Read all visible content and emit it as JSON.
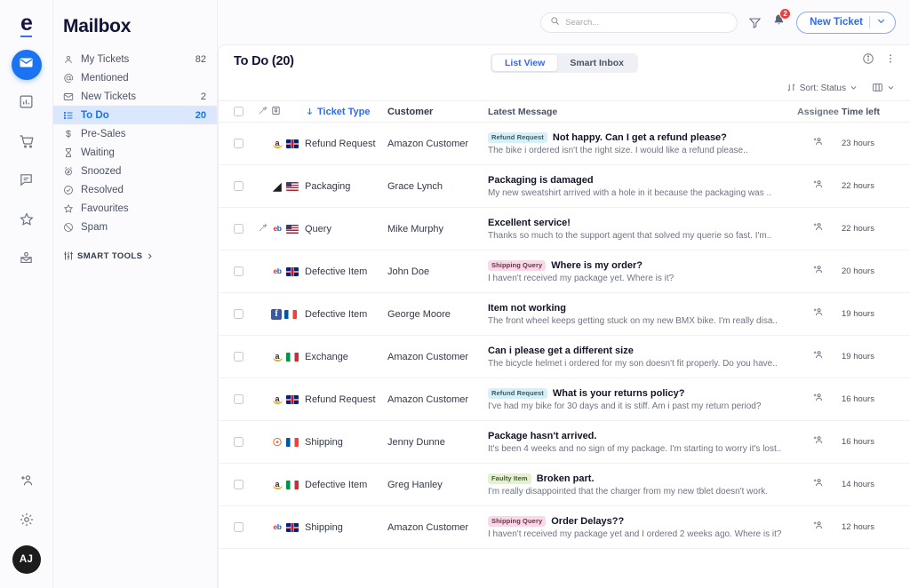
{
  "rail": {
    "logo": "e",
    "items": [
      {
        "name": "mail-icon",
        "active": true
      },
      {
        "name": "chart-icon",
        "active": false
      },
      {
        "name": "cart-icon",
        "active": false
      },
      {
        "name": "chat-icon",
        "active": false
      },
      {
        "name": "star-icon",
        "active": false
      },
      {
        "name": "inbox-person-icon",
        "active": false
      }
    ],
    "bottom": [
      {
        "name": "add-user-icon"
      },
      {
        "name": "gear-icon"
      }
    ],
    "avatar": "AJ"
  },
  "sidebar": {
    "title": "Mailbox",
    "items": [
      {
        "label": "My Tickets",
        "count": "82",
        "icon": "person-icon",
        "active": false
      },
      {
        "label": "Mentioned",
        "count": "",
        "icon": "at-icon",
        "active": false
      },
      {
        "label": "New Tickets",
        "count": "2",
        "icon": "envelope-icon",
        "active": false
      },
      {
        "label": "To Do",
        "count": "20",
        "icon": "list-icon",
        "active": true
      },
      {
        "label": "Pre-Sales",
        "count": "",
        "icon": "dollar-icon",
        "active": false
      },
      {
        "label": "Waiting",
        "count": "",
        "icon": "hourglass-icon",
        "active": false
      },
      {
        "label": "Snoozed",
        "count": "",
        "icon": "alarm-icon",
        "active": false
      },
      {
        "label": "Resolved",
        "count": "",
        "icon": "check-circle-icon",
        "active": false
      },
      {
        "label": "Favourites",
        "count": "",
        "icon": "star-icon",
        "active": false
      },
      {
        "label": "Spam",
        "count": "",
        "icon": "ban-icon",
        "active": false
      }
    ],
    "smart_tools": "SMART TOOLS"
  },
  "topbar": {
    "search_placeholder": "Search...",
    "filter_icon": "filter-icon",
    "bell_icon": "bell-icon",
    "notification_count": "2",
    "new_ticket_label": "New Ticket"
  },
  "panel": {
    "title": "To Do (20)",
    "tabs": [
      {
        "label": "List View",
        "active": true
      },
      {
        "label": "Smart Inbox",
        "active": false
      }
    ],
    "info_icon": "info-icon",
    "more_icon": "more-vertical-icon",
    "sort_label": "Sort: Status",
    "columns_icon": "columns-icon"
  },
  "table": {
    "headers": {
      "checkbox": "",
      "wand": "",
      "channel": "",
      "ticket_type": "Ticket Type",
      "customer": "Customer",
      "latest_message": "Latest Message",
      "assignee": "Assignee",
      "time_left": "Time left"
    },
    "rows": [
      {
        "wand": false,
        "channel": "amazon",
        "flag": "uk",
        "ticket_type": "Refund Request",
        "customer": "Amazon Customer",
        "tag": "Refund Request",
        "tag_style": "tag-refund",
        "subject": "Not happy. Can I get a refund please?",
        "preview": "The bike i ordered isn't the right size. I would like a refund please..",
        "time": "23 hours",
        "bar_pct": 92,
        "bar_color": "#22b24c"
      },
      {
        "wand": false,
        "channel": "dark",
        "flag": "us",
        "ticket_type": "Packaging",
        "customer": "Grace Lynch",
        "tag": "",
        "tag_style": "",
        "subject": "Packaging is damaged",
        "preview": "My new sweatshirt arrived with a hole in it because the packaging was ..",
        "time": "22 hours",
        "bar_pct": 80,
        "bar_color": "#22b24c"
      },
      {
        "wand": true,
        "channel": "ebay",
        "flag": "us",
        "ticket_type": "Query",
        "customer": "Mike Murphy",
        "tag": "",
        "tag_style": "",
        "subject": "Excellent service!",
        "preview": "Thanks so much to the support agent that solved my querie so fast. I'm..",
        "time": "22 hours",
        "bar_pct": 80,
        "bar_color": "#22b24c"
      },
      {
        "wand": false,
        "channel": "ebay",
        "flag": "uk",
        "ticket_type": "Defective Item",
        "customer": "John Doe",
        "tag": "Shipping Query",
        "tag_style": "tag-shipping",
        "subject": "Where is my order?",
        "preview": "I haven't received my package yet. Where is it?",
        "time": "20 hours",
        "bar_pct": 76,
        "bar_color": "#22b24c"
      },
      {
        "wand": false,
        "channel": "facebook",
        "flag": "fr",
        "ticket_type": "Defective Item",
        "customer": "George Moore",
        "tag": "",
        "tag_style": "",
        "subject": "Item not working",
        "preview": "The front wheel keeps getting stuck on my new BMX bike. I'm really disa..",
        "time": "19 hours",
        "bar_pct": 62,
        "bar_color": "#22b24c"
      },
      {
        "wand": false,
        "channel": "amazon",
        "flag": "it",
        "ticket_type": "Exchange",
        "customer": "Amazon Customer",
        "tag": "",
        "tag_style": "",
        "subject": "Can i please get a different size",
        "preview": "The bicycle helmet i ordered for my son doesn't fit properly. Do you have..",
        "time": "19 hours",
        "bar_pct": 62,
        "bar_color": "#22b24c"
      },
      {
        "wand": false,
        "channel": "amazon",
        "flag": "uk",
        "ticket_type": "Refund Request",
        "customer": "Amazon Customer",
        "tag": "Refund Request",
        "tag_style": "tag-refund",
        "subject": "What is your returns policy?",
        "preview": "I've had my bike for 30 days and it is stiff. Am i past my return period?",
        "time": "16 hours",
        "bar_pct": 52,
        "bar_color": "#fbce57"
      },
      {
        "wand": false,
        "channel": "magento",
        "flag": "fr",
        "ticket_type": "Shipping",
        "customer": "Jenny Dunne",
        "tag": "",
        "tag_style": "",
        "subject": "Package hasn't arrived.",
        "preview": "It's been 4 weeks and no sign of my package. I'm starting to worry it's lost..",
        "time": "16 hours",
        "bar_pct": 56,
        "bar_color": "#fbdd8a"
      },
      {
        "wand": false,
        "channel": "amazon",
        "flag": "it",
        "ticket_type": "Defective Item",
        "customer": "Greg Hanley",
        "tag": "Faulty Item",
        "tag_style": "tag-faulty",
        "subject": "Broken part.",
        "preview": "I'm really disappointed that the charger from my new tblet doesn't  work.",
        "time": "14 hours",
        "bar_pct": 56,
        "bar_color": "#fbdd8a"
      },
      {
        "wand": false,
        "channel": "ebay",
        "flag": "uk",
        "ticket_type": "Shipping",
        "customer": "Amazon Customer",
        "tag": "Shipping Query",
        "tag_style": "tag-shipping",
        "subject": "Order Delays??",
        "preview": "I haven't received my package yet and I ordered 2 weeks ago. Where is it?",
        "time": "12 hours",
        "bar_pct": 46,
        "bar_color": "#fbce57"
      }
    ]
  },
  "colors": {
    "accent": "#2f6bf0",
    "active_nav_bg": "#dbe7fd",
    "badge_red": "#ef3e3e",
    "bar_green": "#22b24c",
    "bar_yellow": "#fbce57"
  }
}
